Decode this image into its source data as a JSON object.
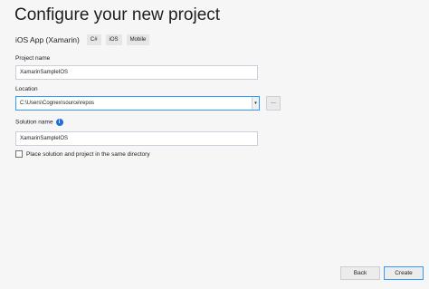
{
  "page": {
    "title": "Configure your new project",
    "template_name": "iOS App (Xamarin)",
    "tags": [
      "C#",
      "iOS",
      "Mobile"
    ]
  },
  "form": {
    "project_name_label": "Project name",
    "project_name_value": "XamarinSampleIOS",
    "location_label": "Location",
    "location_value": "C:\\Users\\Cognex\\source\\repos",
    "location_dropdown_icon": "chevron-down-icon",
    "browse_label": "...",
    "solution_name_label": "Solution name",
    "solution_info_icon": "i",
    "solution_name_value": "XamarinSampleIOS",
    "same_directory_label": "Place solution and project in the same directory",
    "same_directory_checked": false
  },
  "footer": {
    "back_label": "Back",
    "create_label": "Create"
  },
  "colors": {
    "background": "#f6f6f6",
    "focus_border": "#3399ff",
    "info_icon": "#1e6fd9"
  }
}
